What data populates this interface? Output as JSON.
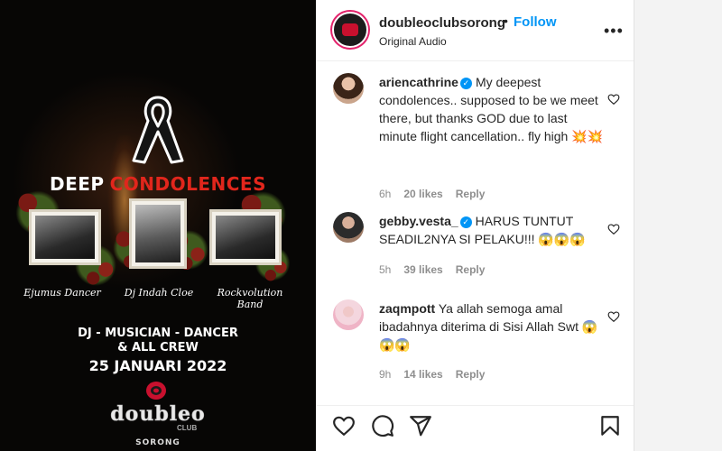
{
  "post": {
    "headline_part1": "DEEP",
    "headline_part2": "CONDOLENCES",
    "captions": [
      "Ejumus Dancer",
      "Dj Indah Cloe",
      "Rockvolution Band"
    ],
    "subline1": "DJ - MUSICIAN - DANCER",
    "subline2": "& ALL CREW",
    "date": "25 JANUARI 2022",
    "logo_name": "doubleo",
    "logo_club": "CLUB",
    "logo_city": "SORONG"
  },
  "header": {
    "username": "doubleoclubsorong",
    "dot": "•",
    "follow_label": "Follow",
    "audio": "Original Audio",
    "more": "•••"
  },
  "comments": [
    {
      "user": "ariencathrine",
      "verified": true,
      "text": "My deepest condolences.. supposed to be we meet there, but thanks GOD due to last minute flight cancellation.. fly high 💥💥",
      "time": "6h",
      "likes": "20 likes",
      "reply": "Reply"
    },
    {
      "user": "gebby.vesta_",
      "verified": true,
      "text": "HARUS TUNTUT SEADIL2NYA SI PELAKU!!! 😱😱😱",
      "time": "5h",
      "likes": "39 likes",
      "reply": "Reply"
    },
    {
      "user": "zaqmpott",
      "verified": false,
      "text": "Ya allah semoga amal ibadahnya diterima di Sisi Allah Swt 😱😱😱",
      "time": "9h",
      "likes": "14 likes",
      "reply": "Reply"
    }
  ],
  "icons": {
    "like": "heart-icon",
    "comment": "comment-icon",
    "share": "share-icon",
    "save": "bookmark-icon"
  },
  "colors": {
    "accent": "#0095f6",
    "headline_red": "#e1261c"
  }
}
